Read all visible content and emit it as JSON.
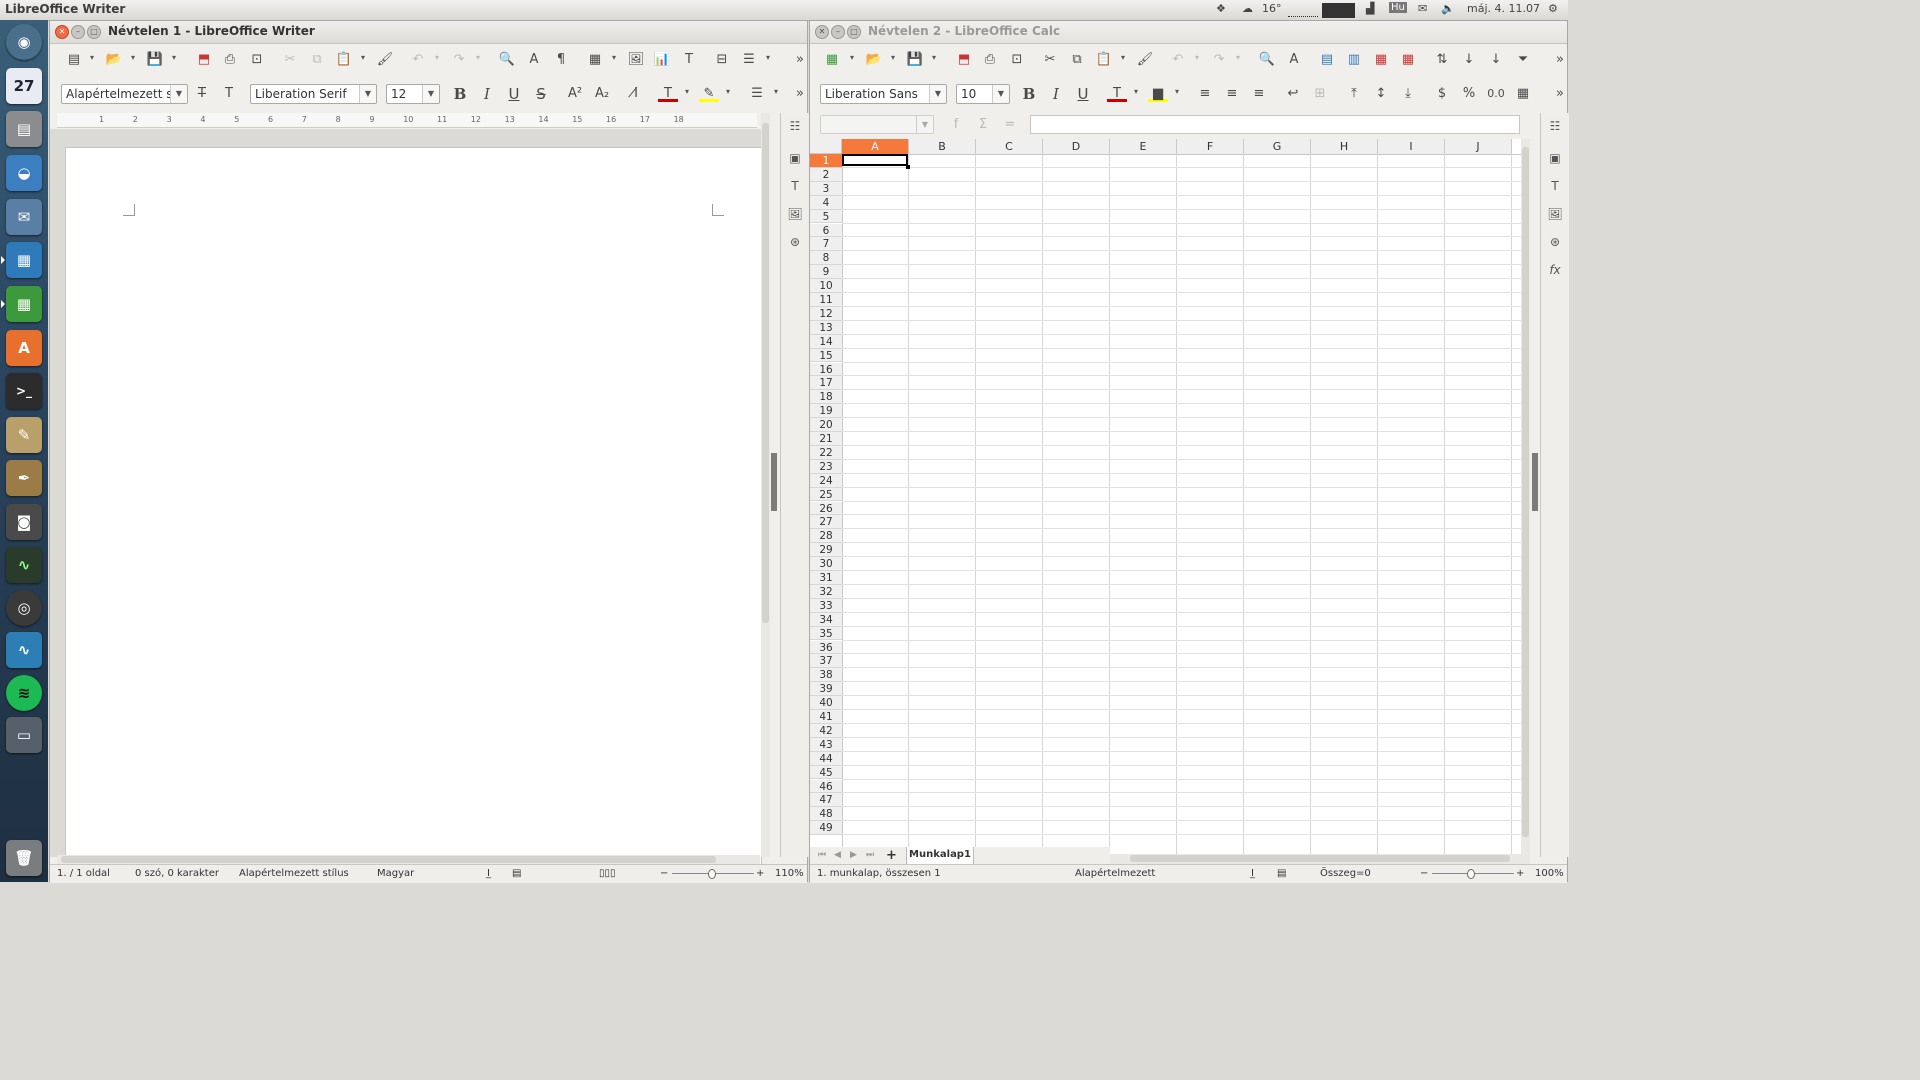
{
  "top_panel": {
    "app_title": "LibreOffice Writer",
    "weather": "16°",
    "keyboard": "Hu",
    "clock": "máj. 4. 11.07"
  },
  "launcher": {
    "calendar_day": "27",
    "items": [
      "dash-icon",
      "calendar-icon",
      "files-icon",
      "browser-icon",
      "mail-icon",
      "writer-icon",
      "calc-icon",
      "software-center-icon",
      "terminal-icon",
      "paint-icon",
      "editor-icon",
      "camera-icon",
      "system-monitor-icon",
      "webcam-icon",
      "graph-icon",
      "spotify-icon",
      "workspace-icon",
      "trash-icon"
    ]
  },
  "writer": {
    "title": "Névtelen 1 - LibreOffice Writer",
    "paragraph_style": "Alapértelmezett st",
    "font_name": "Liberation Serif",
    "font_size": "12",
    "ruler_ticks": [
      "1",
      "2",
      "3",
      "4",
      "5",
      "6",
      "7",
      "8",
      "9",
      "10",
      "11",
      "12",
      "13",
      "14",
      "15",
      "16",
      "17",
      "18"
    ],
    "status": {
      "page": "1. / 1 oldal",
      "words": "0 szó, 0 karakter",
      "style": "Alapértelmezett stílus",
      "language": "Magyar",
      "zoom": "110%"
    }
  },
  "calc": {
    "title": "Névtelen 2 - LibreOffice Calc",
    "font_name": "Liberation Sans",
    "font_size": "10",
    "name_box": "",
    "formula": "",
    "columns": [
      "A",
      "B",
      "C",
      "D",
      "E",
      "F",
      "G",
      "H",
      "I",
      "J"
    ],
    "selected_column": "A",
    "selected_row": 1,
    "row_count": 49,
    "sheet_tab": "Munkalap1",
    "status": {
      "sheet": "1. munkalap, összesen 1",
      "style": "Alapértelmezett",
      "sum": "Összeg=0",
      "zoom": "100%"
    }
  },
  "colors": {
    "selection": "#f4793b",
    "close_button": "#ef6a45",
    "launcher_top": "#3a5f7a"
  }
}
